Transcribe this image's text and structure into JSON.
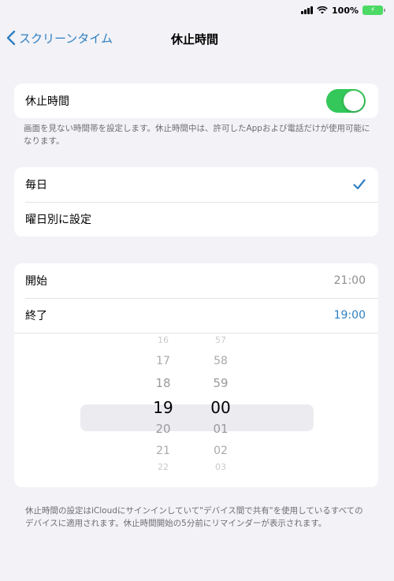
{
  "status": {
    "battery": "100%"
  },
  "nav": {
    "back_label": "スクリーンタイム",
    "title": "休止時間"
  },
  "downtime": {
    "label": "休止時間",
    "enabled": true
  },
  "downtime_note": "画面を見ない時間帯を設定します。休止時間中は、許可したAppおよび電話だけが使用可能になります。",
  "schedule": {
    "every_day": "毎日",
    "custom_days": "曜日別に設定",
    "selected": "every_day"
  },
  "times": {
    "start_label": "開始",
    "start_value": "21:00",
    "end_label": "終了",
    "end_value": "19:00"
  },
  "picker": {
    "hours": [
      "16",
      "17",
      "18",
      "19",
      "20",
      "21",
      "22"
    ],
    "minutes": [
      "57",
      "58",
      "59",
      "00",
      "01",
      "02",
      "03"
    ],
    "selected_hour": "19",
    "selected_minute": "00"
  },
  "bottom_note": "休止時間の設定はiCloudにサインインしていて\"デバイス間で共有\"を使用しているすべてのデバイスに適用されます。休止時間開始の5分前にリマインダーが表示されます。",
  "colors": {
    "accent": "#2f7fc1",
    "toggle_on": "#34c759",
    "background": "#f2f2f7"
  }
}
